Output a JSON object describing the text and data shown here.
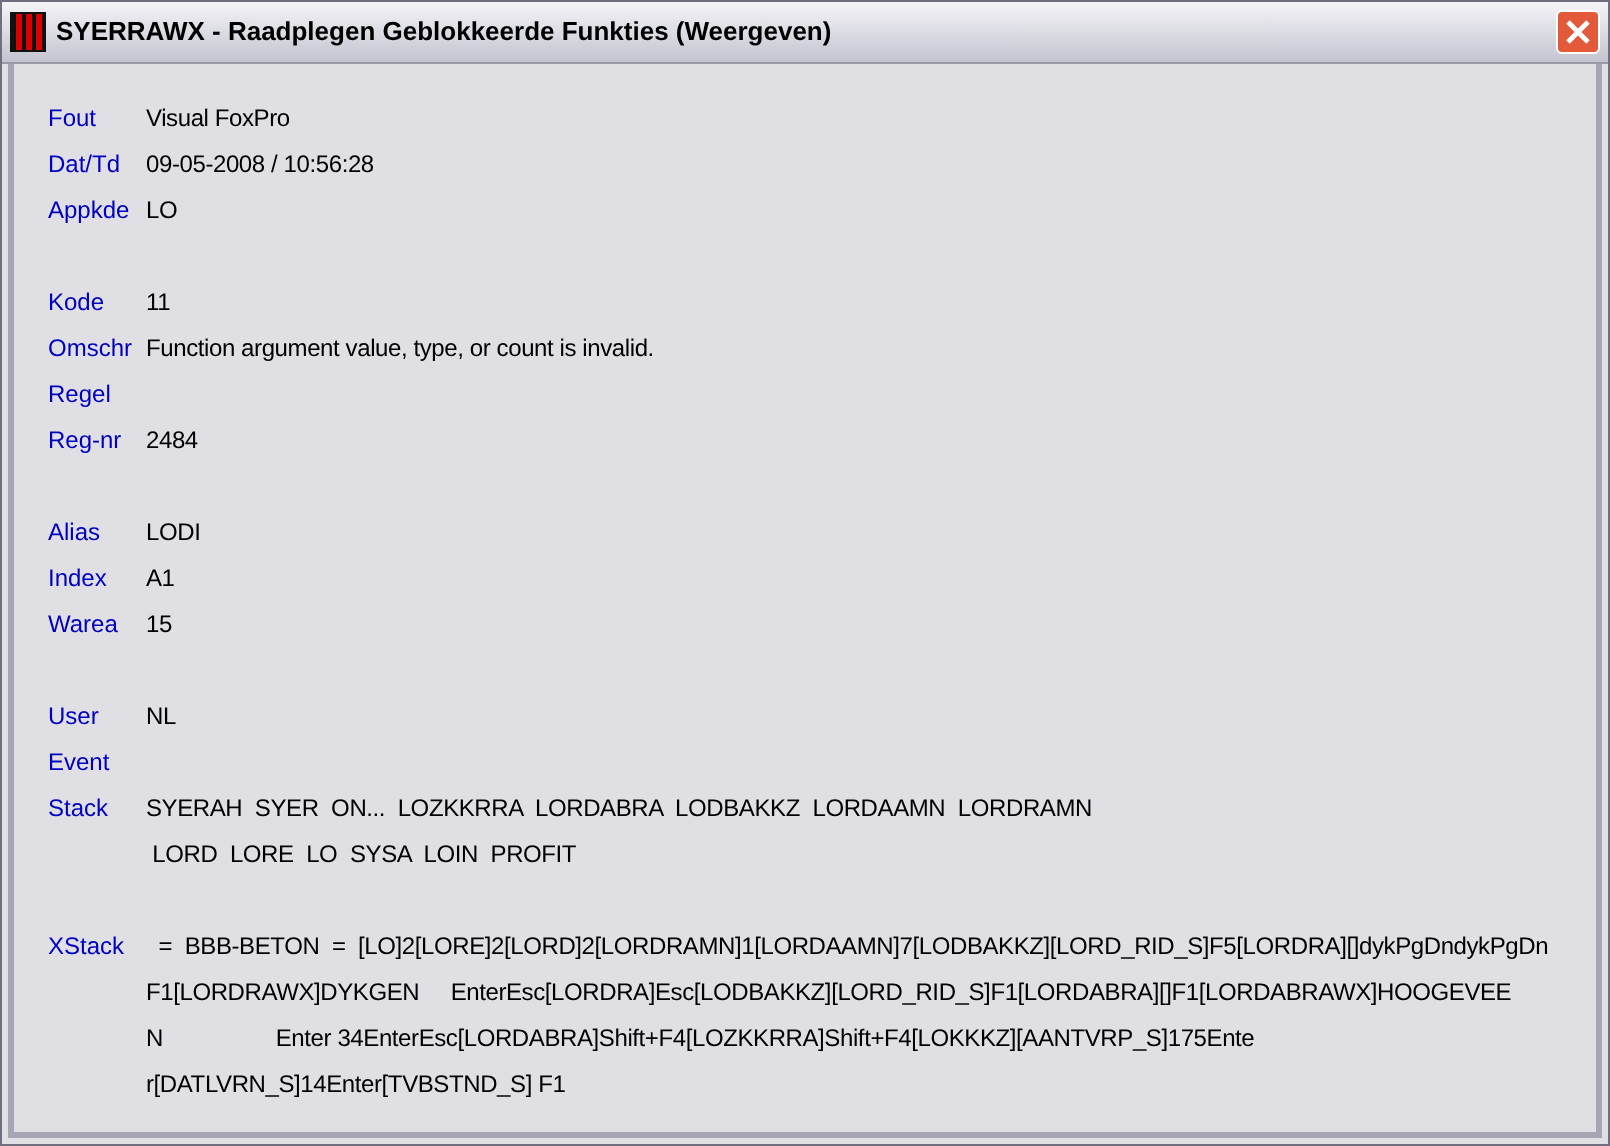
{
  "window": {
    "title": "SYERRAWX - Raadplegen Geblokkeerde Funkties (Weergeven)"
  },
  "groups": [
    {
      "fields": [
        {
          "label": "Fout",
          "lines": [
            "Visual FoxPro"
          ]
        },
        {
          "label": "Dat/Td",
          "lines": [
            "09-05-2008 / 10:56:28"
          ]
        },
        {
          "label": "Appkde",
          "lines": [
            "LO"
          ]
        }
      ]
    },
    {
      "fields": [
        {
          "label": "Kode",
          "lines": [
            "11"
          ]
        },
        {
          "label": "Omschr",
          "lines": [
            "Function argument value, type, or count is invalid."
          ]
        },
        {
          "label": "Regel"
        },
        {
          "label": "Reg-nr",
          "lines": [
            "2484"
          ]
        }
      ]
    },
    {
      "fields": [
        {
          "label": "Alias",
          "lines": [
            "LODI"
          ]
        },
        {
          "label": "Index",
          "lines": [
            "A1"
          ]
        },
        {
          "label": "Warea",
          "lines": [
            "15"
          ]
        }
      ]
    },
    {
      "fields": [
        {
          "label": "User",
          "lines": [
            "NL"
          ]
        },
        {
          "label": "Event"
        },
        {
          "label": "Stack",
          "lines": [
            "SYERAH  SYER  ON...  LOZKKRRA  LORDABRA  LODBAKKZ  LORDAAMN  LORDRAMN",
            " LORD  LORE  LO  SYSA  LOIN  PROFIT"
          ]
        }
      ]
    },
    {
      "fields": [
        {
          "label": "XStack",
          "lines": [
            "  =  BBB-BETON  =  [LO]2[LORE]2[LORD]2[LORDRAMN]1[LORDAAMN]7[LODBAKKZ][LORD_RID_S]F5[LORDRA][]dykPgDndykPgDn",
            "F1[LORDRAWX]DYKGEN     EnterEsc[LORDRA]Esc[LODBAKKZ][LORD_RID_S]F1[LORDABRA][]F1[LORDABRAWX]HOOGEVEE",
            "N                  Enter 34EnterEsc[LORDABRA]Shift+F4[LOZKKRRA]Shift+F4[LOKKKZ][AANTVRP_S]175Ente",
            "r[DATLVRN_S]14Enter[TVBSTND_S] F1"
          ]
        }
      ]
    }
  ]
}
